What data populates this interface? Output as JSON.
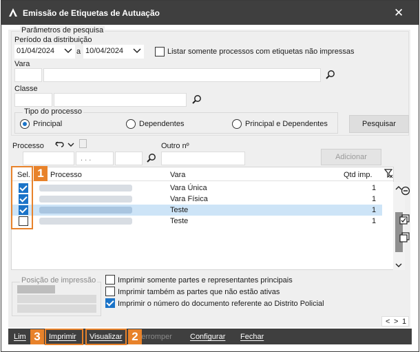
{
  "window": {
    "title": "Emissão de Etiquetas de Autuação",
    "close_glyph": "✕"
  },
  "search": {
    "group_label": "Parâmetros de pesquisa",
    "period_label": "Período da distribuição",
    "date_from": "01/04/2024",
    "date_sep": "a",
    "date_to": "10/04/2024",
    "only_unprinted_label": "Listar somente processos com etiquetas não impressas",
    "vara_label": "Vara",
    "classe_label": "Classe",
    "tipo_label": "Tipo do processo",
    "tipo_options": [
      "Principal",
      "Dependentes",
      "Principal e Dependentes"
    ],
    "tipo_selected": "Principal",
    "search_button": "Pesquisar"
  },
  "processo": {
    "label": "Processo",
    "other_label": "Outro nº",
    "mask": ". . .",
    "add_button": "Adicionar"
  },
  "grid": {
    "columns": [
      "Sel.",
      "Processo",
      "Vara",
      "Qtd imp."
    ],
    "rows": [
      {
        "checked": true,
        "vara": "Vara Única",
        "qtd": "1",
        "selected": false
      },
      {
        "checked": true,
        "vara": "Vara Física",
        "qtd": "1",
        "selected": false
      },
      {
        "checked": true,
        "vara": "Teste",
        "qtd": "1",
        "selected": true
      },
      {
        "checked": false,
        "vara": "Teste",
        "qtd": "1",
        "selected": false
      }
    ]
  },
  "print_position": {
    "label": "Posição de impressão"
  },
  "options": [
    {
      "label": "Imprimir somente partes e representantes principais",
      "checked": false
    },
    {
      "label": "Imprimir também as partes que não estão ativas",
      "checked": false
    },
    {
      "label": "Imprimir o número do documento referente ao Distrito Policial",
      "checked": true
    }
  ],
  "pager": {
    "prev": "<",
    "next": ">",
    "page": "1"
  },
  "toolbar": {
    "items": [
      "Limpar",
      "Imprimir",
      "Visualizar",
      "Interromper",
      "Configurar",
      "Fechar"
    ],
    "partial_first": "Lim"
  },
  "callouts": [
    "1",
    "2",
    "3"
  ],
  "accent": "#1a73c8",
  "callout_color": "#e8822a"
}
